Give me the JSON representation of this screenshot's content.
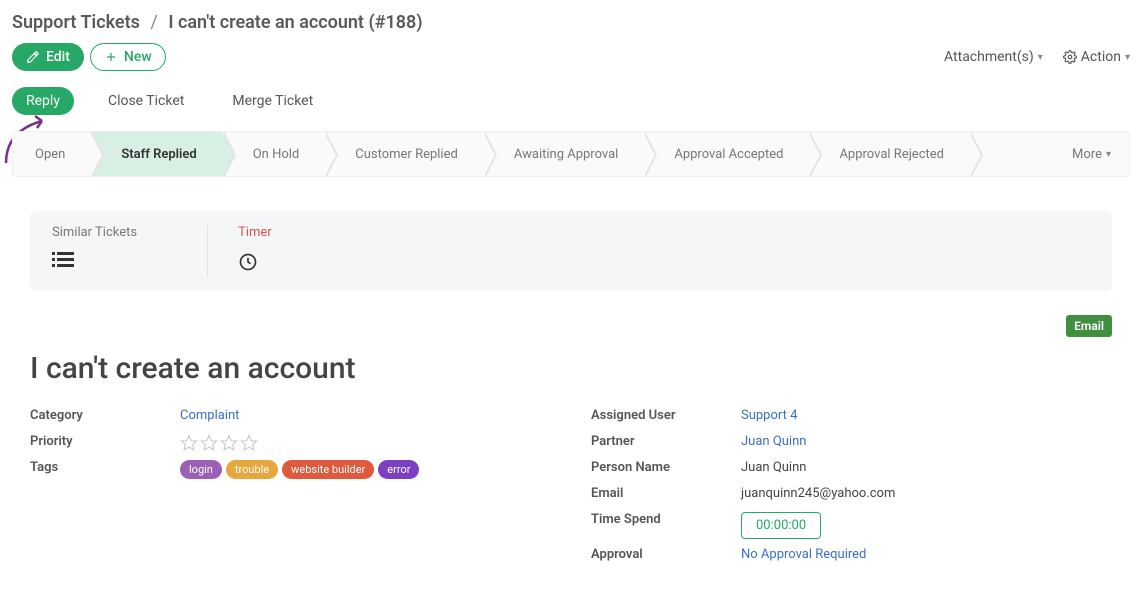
{
  "breadcrumb": {
    "root": "Support Tickets",
    "current": "I can't create an account (#188)"
  },
  "buttons": {
    "edit": "Edit",
    "new": "New",
    "attachments": "Attachment(s)",
    "action": "Action"
  },
  "secTabs": {
    "reply": "Reply",
    "close": "Close Ticket",
    "merge": "Merge Ticket"
  },
  "stages": [
    {
      "label": "Open",
      "active": false
    },
    {
      "label": "Staff Replied",
      "active": true
    },
    {
      "label": "On Hold",
      "active": false
    },
    {
      "label": "Customer Replied",
      "active": false
    },
    {
      "label": "Awaiting Approval",
      "active": false
    },
    {
      "label": "Approval Accepted",
      "active": false
    },
    {
      "label": "Approval Rejected",
      "active": false
    }
  ],
  "stages_more": "More",
  "util": {
    "similar": "Similar Tickets",
    "timer": "Timer"
  },
  "source_badge": "Email",
  "title": "I can't create an account",
  "leftFields": {
    "category_label": "Category",
    "category_value": "Complaint",
    "priority_label": "Priority",
    "tags_label": "Tags"
  },
  "tags": [
    {
      "text": "login",
      "color": "#9b5fb6"
    },
    {
      "text": "trouble",
      "color": "#e6a83c"
    },
    {
      "text": "website builder",
      "color": "#e0593c"
    },
    {
      "text": "error",
      "color": "#7b3fbf"
    }
  ],
  "rightFields": {
    "assigned_label": "Assigned User",
    "assigned_value": "Support 4",
    "partner_label": "Partner",
    "partner_value": "Juan Quinn",
    "person_label": "Person Name",
    "person_value": "Juan Quinn",
    "email_label": "Email",
    "email_value": "juanquinn245@yahoo.com",
    "time_label": "Time Spend",
    "time_value": "00:00:00",
    "approval_label": "Approval",
    "approval_value": "No Approval Required"
  }
}
